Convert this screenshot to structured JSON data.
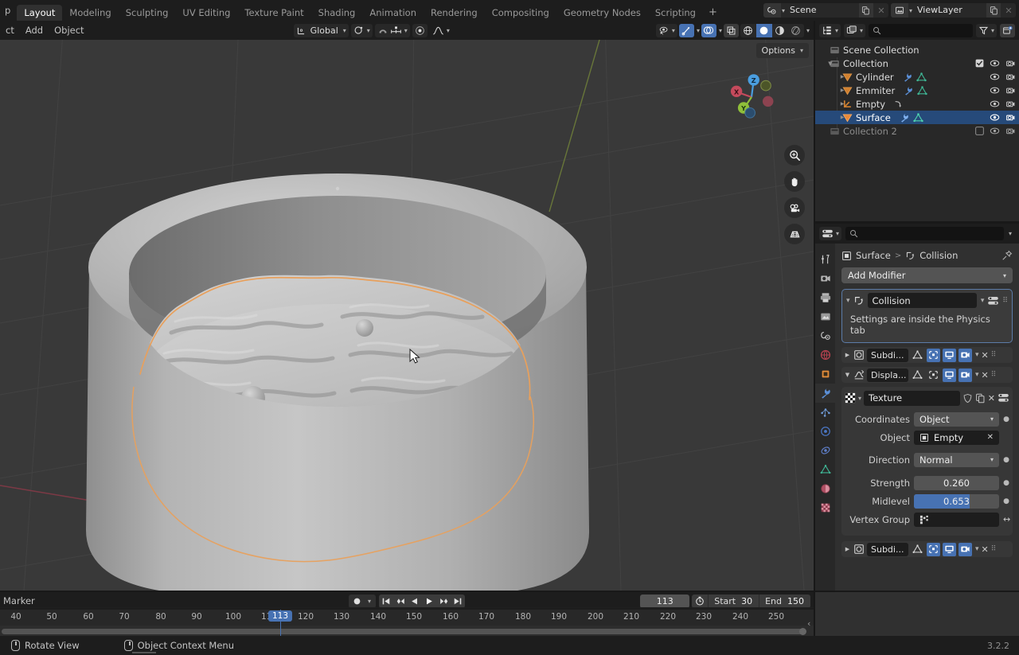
{
  "topbar": {
    "menus": [
      "p"
    ],
    "workspace_tabs": [
      {
        "label": "Layout",
        "active": true
      },
      {
        "label": "Modeling",
        "active": false
      },
      {
        "label": "Sculpting",
        "active": false
      },
      {
        "label": "UV Editing",
        "active": false
      },
      {
        "label": "Texture Paint",
        "active": false
      },
      {
        "label": "Shading",
        "active": false
      },
      {
        "label": "Animation",
        "active": false
      },
      {
        "label": "Rendering",
        "active": false
      },
      {
        "label": "Compositing",
        "active": false
      },
      {
        "label": "Geometry Nodes",
        "active": false
      },
      {
        "label": "Scripting",
        "active": false
      }
    ],
    "add_tab": "+",
    "scene": {
      "label": "Scene",
      "icon": "scene-icon"
    },
    "viewlayer": {
      "label": "ViewLayer",
      "icon": "viewlayer-icon"
    }
  },
  "viewport": {
    "menus": [
      "ct",
      "Add",
      "Object"
    ],
    "transform_orientation": "Global",
    "options_label": "Options",
    "gizmo_axes": [
      "X",
      "Y",
      "Z"
    ],
    "nav_icons": [
      "zoom-icon",
      "hand-icon",
      "camera-icon",
      "grid-icon"
    ]
  },
  "outliner": {
    "search_placeholder": "",
    "rows": [
      {
        "label": "Scene Collection",
        "indent": 0,
        "icon": "collection-icon",
        "selected": false,
        "dim": false,
        "disclosure": "",
        "checkbox": false,
        "eye": false,
        "camera": false
      },
      {
        "label": "Collection",
        "indent": 1,
        "icon": "collection-icon",
        "selected": false,
        "dim": false,
        "disclosure": "down",
        "checkbox": true,
        "eye": true,
        "camera": true
      },
      {
        "label": "Cylinder",
        "indent": 2,
        "icon": "mesh-icon",
        "selected": false,
        "dim": false,
        "disclosure": "right",
        "checkbox": false,
        "eye": true,
        "camera": true,
        "badges": [
          "wrench-icon",
          "mesh-data-icon"
        ]
      },
      {
        "label": "Emmiter",
        "indent": 2,
        "icon": "mesh-icon",
        "selected": false,
        "dim": false,
        "disclosure": "right",
        "checkbox": false,
        "eye": true,
        "camera": true,
        "badges": [
          "wrench-icon",
          "mesh-data-icon"
        ]
      },
      {
        "label": "Empty",
        "indent": 2,
        "icon": "empty-icon",
        "selected": false,
        "dim": false,
        "disclosure": "right",
        "checkbox": false,
        "eye": true,
        "camera": true,
        "badges": [
          "constraint-icon"
        ]
      },
      {
        "label": "Surface",
        "indent": 2,
        "icon": "mesh-icon",
        "selected": true,
        "dim": false,
        "disclosure": "right",
        "checkbox": false,
        "eye": true,
        "camera": true,
        "badges": [
          "wrench-icon",
          "mesh-data-icon"
        ]
      },
      {
        "label": "Collection 2",
        "indent": 1,
        "icon": "collection-icon",
        "selected": false,
        "dim": true,
        "disclosure": "",
        "checkbox": true,
        "eye": true,
        "camera": true
      }
    ]
  },
  "properties": {
    "search_placeholder": "",
    "breadcrumb": {
      "object": "Surface",
      "separator": ">",
      "context": "Collision"
    },
    "add_modifier": "Add Modifier",
    "modifiers": [
      {
        "name": "Collision",
        "expanded": true,
        "note": "Settings are inside the Physics tab",
        "icon": "collision-icon"
      },
      {
        "name": "Subdi...",
        "expanded": false,
        "icon": "subsurf-icon",
        "toggles": [
          false,
          true,
          true,
          true
        ]
      },
      {
        "name": "Displa...",
        "expanded": true,
        "icon": "displace-icon",
        "toggles": [
          false,
          false,
          true,
          true
        ]
      }
    ],
    "displace": {
      "texture_name": "Texture",
      "fields": [
        {
          "label": "Coordinates",
          "value": "Object",
          "type": "dropdown"
        },
        {
          "label": "Object",
          "value": "Empty",
          "type": "object"
        },
        {
          "label": "Direction",
          "value": "Normal",
          "type": "dropdown"
        },
        {
          "label": "Strength",
          "value": "0.260",
          "type": "number",
          "fill": 0
        },
        {
          "label": "Midlevel",
          "value": "0.653",
          "type": "slider",
          "fill": 65
        },
        {
          "label": "Vertex Group",
          "value": "",
          "type": "vgroup"
        }
      ]
    },
    "last_modifier": {
      "name": "Subdi...",
      "icon": "subsurf-icon",
      "toggles": [
        false,
        true,
        true,
        true
      ]
    },
    "tabs": [
      "tool-icon",
      "render-icon",
      "output-icon",
      "viewlayer-props-icon",
      "scene-props-icon",
      "world-icon",
      "object-icon",
      "modifier-icon",
      "particles-icon",
      "physics-icon",
      "constraints-icon",
      "data-icon",
      "material-icon",
      "texture-icon"
    ]
  },
  "timeline": {
    "marker_label": "Marker",
    "playback_buttons": [
      "jump-start-icon",
      "prev-keyframe-icon",
      "play-reverse-icon",
      "play-icon",
      "next-keyframe-icon",
      "jump-end-icon"
    ],
    "current_frame": "113",
    "start_label": "Start",
    "start_value": "30",
    "end_label": "End",
    "end_value": "150",
    "ruler_ticks": [
      40,
      50,
      60,
      70,
      80,
      90,
      100,
      110,
      120,
      130,
      140,
      150,
      160,
      170,
      180,
      190,
      200,
      210,
      220,
      230,
      240,
      250
    ],
    "playhead_frame": "113"
  },
  "status": {
    "items": [
      {
        "icon": "mouse-left-icon",
        "label": "Rotate View"
      },
      {
        "icon": "mouse-right-icon",
        "label": "Object Context Menu"
      }
    ],
    "version": "3.2.2"
  },
  "colors": {
    "accent": "#4772b3",
    "selection_outline": "#e8a05c",
    "panel_bg": "#303030",
    "header_bg": "#1d1d1d",
    "viewport_bg": "#393939"
  }
}
